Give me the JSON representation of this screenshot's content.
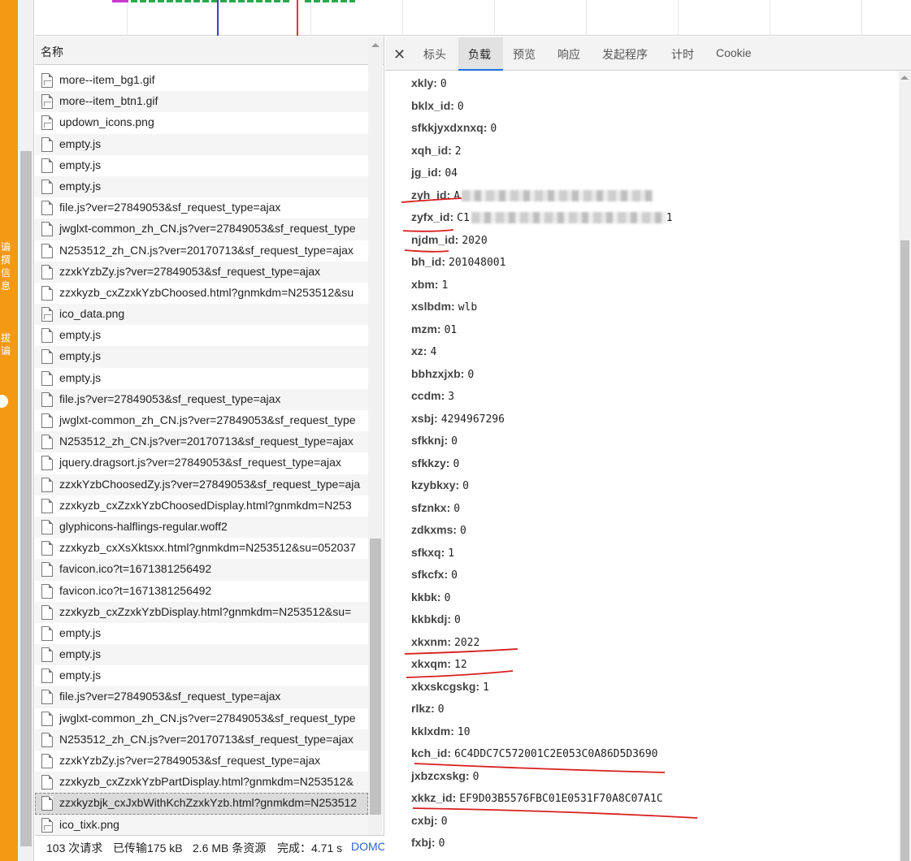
{
  "sidebar": {
    "vertical_text_1": "谝\n撰\n信\n息",
    "vertical_text_2": "拔\n谝"
  },
  "request_list": {
    "header": "名称",
    "rows": [
      {
        "name": "more--item_bg1.gif",
        "type": "img"
      },
      {
        "name": "more--item_btn1.gif",
        "type": "img"
      },
      {
        "name": "updown_icons.png",
        "type": "img"
      },
      {
        "name": "empty.js",
        "type": "doc"
      },
      {
        "name": "empty.js",
        "type": "doc"
      },
      {
        "name": "empty.js",
        "type": "doc"
      },
      {
        "name": "file.js?ver=27849053&sf_request_type=ajax",
        "type": "doc"
      },
      {
        "name": "jwglxt-common_zh_CN.js?ver=27849053&sf_request_type",
        "type": "doc"
      },
      {
        "name": "N253512_zh_CN.js?ver=20170713&sf_request_type=ajax",
        "type": "doc"
      },
      {
        "name": "zzxkYzbZy.js?ver=27849053&sf_request_type=ajax",
        "type": "doc"
      },
      {
        "name": "zzxkyzb_cxZzxkYzbChoosed.html?gnmkdm=N253512&su",
        "type": "doc"
      },
      {
        "name": "ico_data.png",
        "type": "img"
      },
      {
        "name": "empty.js",
        "type": "doc"
      },
      {
        "name": "empty.js",
        "type": "doc"
      },
      {
        "name": "empty.js",
        "type": "doc"
      },
      {
        "name": "file.js?ver=27849053&sf_request_type=ajax",
        "type": "doc"
      },
      {
        "name": "jwglxt-common_zh_CN.js?ver=27849053&sf_request_type",
        "type": "doc"
      },
      {
        "name": "N253512_zh_CN.js?ver=20170713&sf_request_type=ajax",
        "type": "doc"
      },
      {
        "name": "jquery.dragsort.js?ver=27849053&sf_request_type=ajax",
        "type": "doc"
      },
      {
        "name": "zzxkYzbChoosedZy.js?ver=27849053&sf_request_type=aja",
        "type": "doc"
      },
      {
        "name": "zzxkyzb_cxZzxkYzbChoosedDisplay.html?gnmkdm=N253",
        "type": "doc"
      },
      {
        "name": "glyphicons-halflings-regular.woff2",
        "type": "doc"
      },
      {
        "name": "zzxkyzb_cxXsXktsxx.html?gnmkdm=N253512&su=052037",
        "type": "doc"
      },
      {
        "name": "favicon.ico?t=1671381256492",
        "type": "doc"
      },
      {
        "name": "favicon.ico?t=1671381256492",
        "type": "doc"
      },
      {
        "name": "zzxkyzb_cxZzxkYzbDisplay.html?gnmkdm=N253512&su=",
        "type": "doc"
      },
      {
        "name": "empty.js",
        "type": "doc"
      },
      {
        "name": "empty.js",
        "type": "doc"
      },
      {
        "name": "empty.js",
        "type": "doc"
      },
      {
        "name": "file.js?ver=27849053&sf_request_type=ajax",
        "type": "doc"
      },
      {
        "name": "jwglxt-common_zh_CN.js?ver=27849053&sf_request_type",
        "type": "doc"
      },
      {
        "name": "N253512_zh_CN.js?ver=20170713&sf_request_type=ajax",
        "type": "doc"
      },
      {
        "name": "zzxkYzbZy.js?ver=27849053&sf_request_type=ajax",
        "type": "doc"
      },
      {
        "name": "zzxkyzb_cxZzxkYzbPartDisplay.html?gnmkdm=N253512&",
        "type": "doc"
      },
      {
        "name": "zzxkyzbjk_cxJxbWithKchZzxkYzb.html?gnmkdm=N253512",
        "type": "doc",
        "selected": true
      },
      {
        "name": "ico_tixk.png",
        "type": "img"
      }
    ]
  },
  "status_bar": {
    "requests": "103 次请求",
    "transferred": "已传输175 kB",
    "resources": "2.6 MB 条资源",
    "finish": "完成：4.71 s",
    "dom": "DOMC"
  },
  "tabs": {
    "close": "✕",
    "items": [
      "标头",
      "负载",
      "预览",
      "响应",
      "发起程序",
      "计时",
      "Cookie"
    ],
    "active": "负载"
  },
  "payload": [
    {
      "key": "xkly:",
      "value": "0"
    },
    {
      "key": "bklx_id:",
      "value": "0"
    },
    {
      "key": "sfkkjyxdxnxq:",
      "value": "0"
    },
    {
      "key": "xqh_id:",
      "value": "2"
    },
    {
      "key": "jg_id:",
      "value": "04"
    },
    {
      "key": "zyh_id:",
      "value": "A",
      "blurred": true
    },
    {
      "key": "zyfx_id:",
      "value": "C1",
      "blurred": true,
      "suffix": "1"
    },
    {
      "key": "njdm_id:",
      "value": "2020"
    },
    {
      "key": "bh_id:",
      "value": "201048001"
    },
    {
      "key": "xbm:",
      "value": "1"
    },
    {
      "key": "xslbdm:",
      "value": "wlb"
    },
    {
      "key": "mzm:",
      "value": "01"
    },
    {
      "key": "xz:",
      "value": "4"
    },
    {
      "key": "bbhzxjxb:",
      "value": "0"
    },
    {
      "key": "ccdm:",
      "value": "3"
    },
    {
      "key": "xsbj:",
      "value": "4294967296"
    },
    {
      "key": "sfkknj:",
      "value": "0"
    },
    {
      "key": "sfkkzy:",
      "value": "0"
    },
    {
      "key": "kzybkxy:",
      "value": "0"
    },
    {
      "key": "sfznkx:",
      "value": "0"
    },
    {
      "key": "zdkxms:",
      "value": "0"
    },
    {
      "key": "sfkxq:",
      "value": "1"
    },
    {
      "key": "sfkcfx:",
      "value": "0"
    },
    {
      "key": "kkbk:",
      "value": "0"
    },
    {
      "key": "kkbkdj:",
      "value": "0"
    },
    {
      "key": "xkxnm:",
      "value": "2022"
    },
    {
      "key": "xkxqm:",
      "value": "12"
    },
    {
      "key": "xkxskcgskg:",
      "value": "1"
    },
    {
      "key": "rlkz:",
      "value": "0"
    },
    {
      "key": "kklxdm:",
      "value": "10"
    },
    {
      "key": "kch_id:",
      "value": "6C4DDC7C572001C2E053C0A86D5D3690"
    },
    {
      "key": "jxbzcxskg:",
      "value": "0"
    },
    {
      "key": "xkkz_id:",
      "value": "EF9D03B5576FBC01E0531F70A8C07A1C"
    },
    {
      "key": "cxbj:",
      "value": "0"
    },
    {
      "key": "fxbj:",
      "value": "0"
    }
  ],
  "colors": {
    "orange_strip": "#f39a12",
    "annotation_red": "#d81e1e",
    "active_tab_underline": "#1a73e8"
  }
}
